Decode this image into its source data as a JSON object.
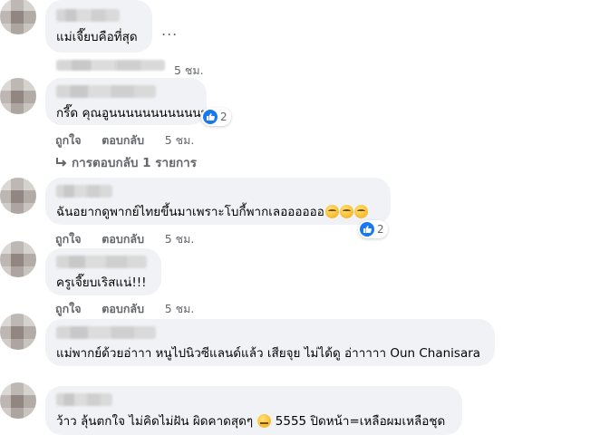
{
  "actions": {
    "like": "ถูกใจ",
    "reply": "ตอบกลับ"
  },
  "more_options": "...",
  "comments": [
    {
      "text": "แม่เจี๊ยบคือที่สุด",
      "time": "5 ชม."
    },
    {
      "text": "กรี๊ด คุณอูนนนนนนนนนนนน",
      "reactions": "2",
      "time": "5 ชม.",
      "replies_link": "การตอบกลับ 1 รายการ"
    },
    {
      "text": "ฉันอยากดูพากย์ไทยขึ้นมาเพราะโบกี้พากเลออออออ",
      "reactions": "2",
      "time": "5 ชม."
    },
    {
      "text": "ครูเจี๊ยบเริสแน่!!!",
      "time": "5 ชม."
    },
    {
      "text": "แม่พากย์ด้วยอ่าาา หนูไปนิวซีแลนด์แล้ว เสียจุย ไม่ได้ดู อ่าาาาา Oun Chanisara"
    },
    {
      "text_before": "ว้าว ลุ้นตกใจ ไม่คิดไม่ฝัน ผิดคาดสุดๆ",
      "text_after": "5555 ปิดหน้า=เหลือผมเหลือชุด"
    }
  ],
  "colors": {
    "bubble": "#f0f2f5",
    "meta": "#65676b",
    "like_blue": "#1877f2"
  }
}
